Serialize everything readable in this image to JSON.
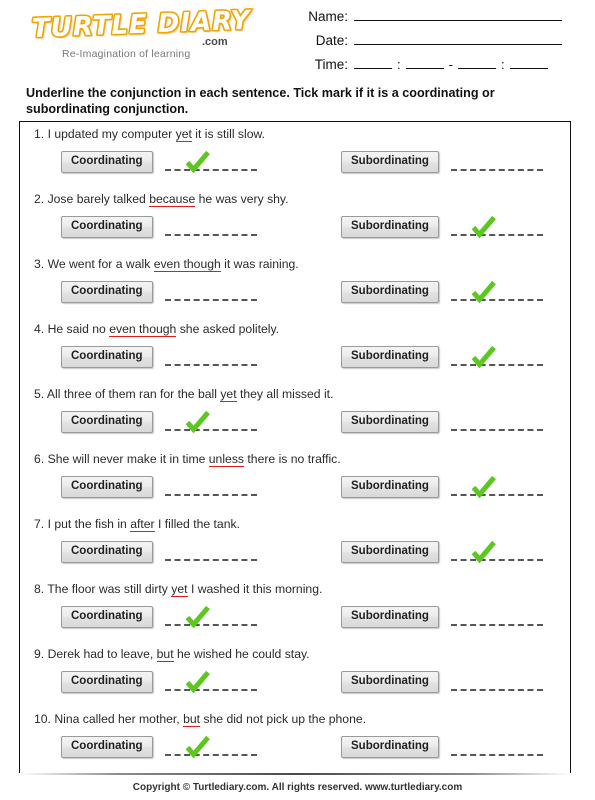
{
  "logo": {
    "word": "TURTLE DIARY",
    "dotcom": ".com",
    "tagline": "Re-Imagination of learning"
  },
  "header_fields": {
    "name_label": "Name:",
    "date_label": "Date:",
    "time_label": "Time:",
    "time_sep_colon_1": ":",
    "time_sep_dash": "-",
    "time_sep_colon_2": ":"
  },
  "instruction": "Underline the conjunction in each sentence. Tick mark if it is a coordinating or subordinating conjunction.",
  "labels": {
    "coordinating": "Coordinating",
    "subordinating": "Subordinating"
  },
  "colors": {
    "underline_red": "#e01b1b",
    "check_green": "#5bc81e",
    "dash_gray": "#55565a",
    "logo_orange": "#f0a500"
  },
  "questions": [
    {
      "num": "1.",
      "before": "I updated my computer ",
      "conjunction": "yet",
      "after": " it is still slow.",
      "answer": "coordinating"
    },
    {
      "num": "2.",
      "before": "Jose barely talked ",
      "conjunction": "because",
      "after": " he was very shy.",
      "answer": "subordinating"
    },
    {
      "num": "3.",
      "before": "We went for a walk ",
      "conjunction": "even though",
      "after": " it was raining.",
      "answer": "subordinating"
    },
    {
      "num": "4.",
      "before": "He said no ",
      "conjunction": "even though",
      "after": " she asked politely.",
      "answer": "subordinating"
    },
    {
      "num": "5.",
      "before": "All three of them ran for the ball ",
      "conjunction": "yet",
      "after": " they all missed it.",
      "answer": "coordinating"
    },
    {
      "num": "6.",
      "before": "She will never make it in time ",
      "conjunction": "unless",
      "after": " there is no traffic.",
      "answer": "subordinating"
    },
    {
      "num": "7.",
      "before": "I put the fish in ",
      "conjunction": "after",
      "after": " I filled the tank.",
      "answer": "subordinating"
    },
    {
      "num": "8.",
      "before": "The floor was still dirty ",
      "conjunction": "yet",
      "after": " I washed it this morning.",
      "answer": "coordinating"
    },
    {
      "num": "9.",
      "before": "Derek had to leave, ",
      "conjunction": "but",
      "after": " he wished he could stay.",
      "answer": "coordinating"
    },
    {
      "num": "10.",
      "before": "Nina called her mother, ",
      "conjunction": "but",
      "after": " she did not pick up the phone.",
      "answer": "coordinating"
    }
  ],
  "footer": "Copyright © Turtlediary.com. All rights reserved. www.turtlediary.com"
}
